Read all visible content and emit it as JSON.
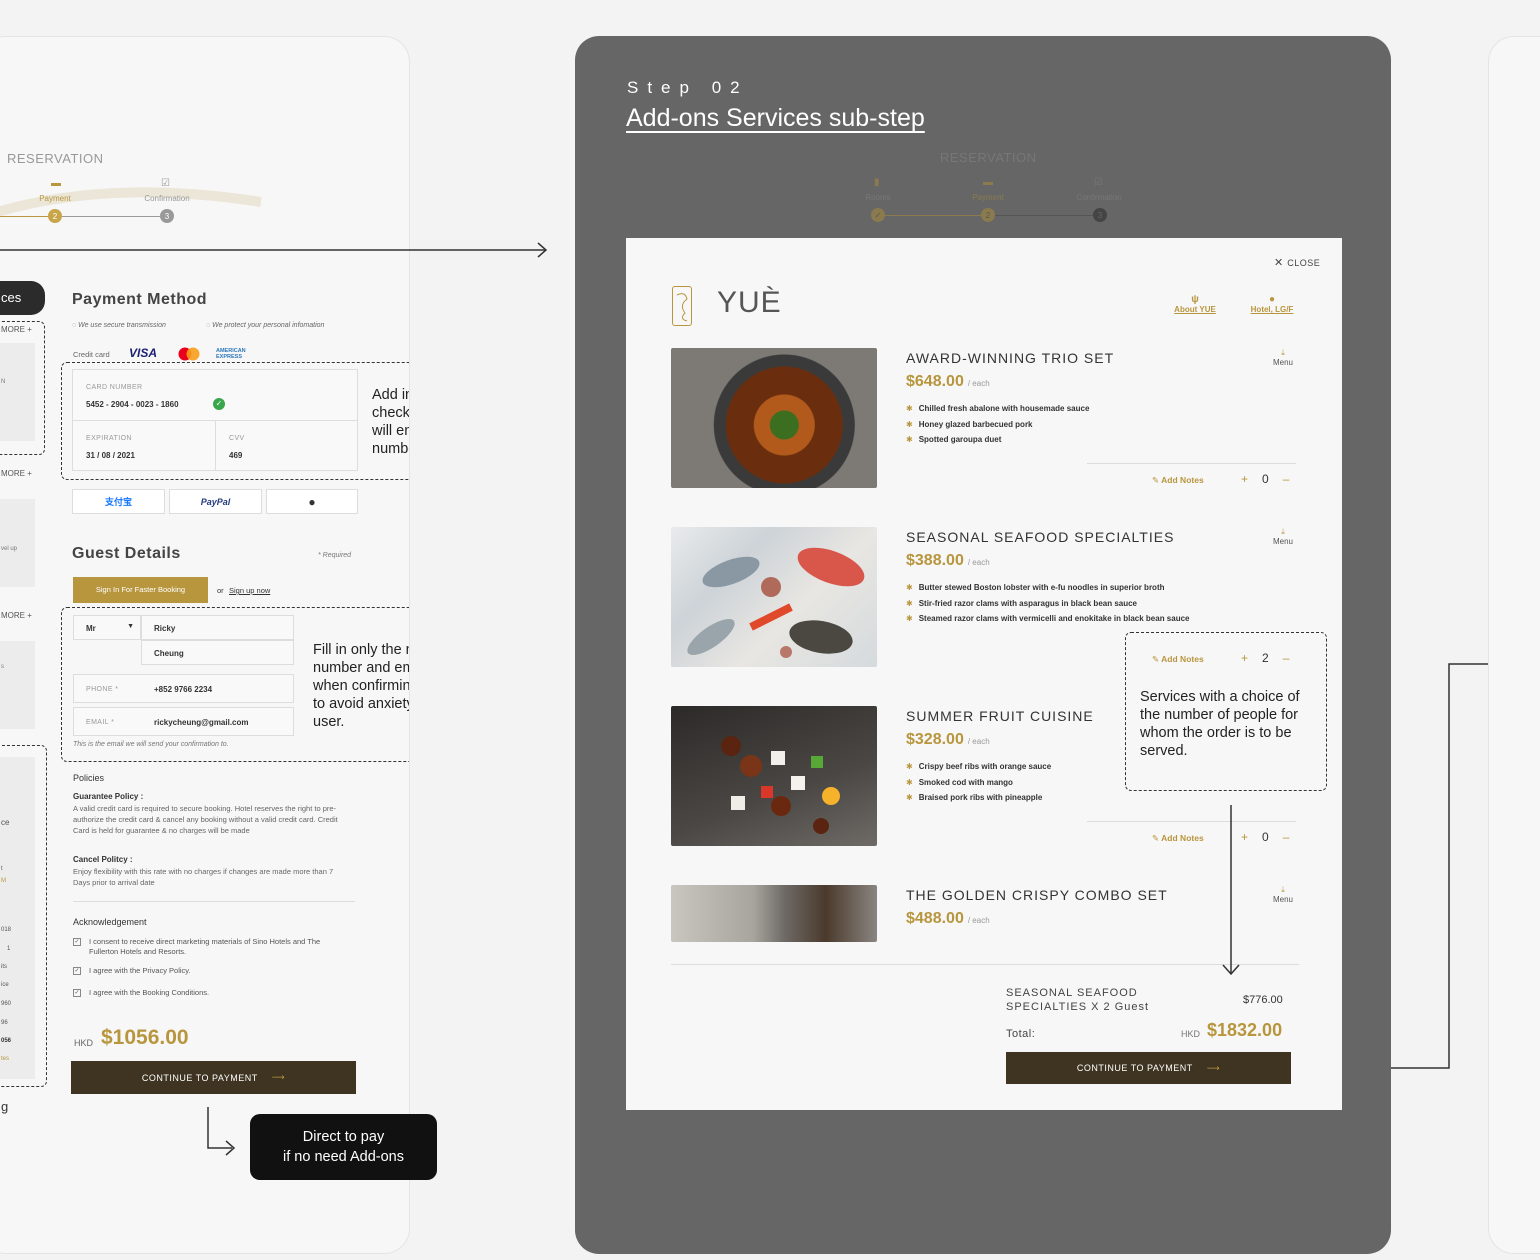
{
  "left": {
    "reservation": "RESERVATION",
    "steps": [
      {
        "label": "Payment",
        "num": "2"
      },
      {
        "label": "Confirmation",
        "num": "3"
      }
    ],
    "tab_partial": "ces",
    "more": "MORE +",
    "side_fragments": [
      "N",
      "vel up",
      "s",
      "ce",
      "t",
      "M",
      "018",
      "1",
      "its",
      "ice",
      "960",
      "96",
      "056",
      "tes",
      "g"
    ],
    "payment_method": {
      "title": "Payment Method",
      "secure1": "We use secure transmission",
      "secure2": "We protect your personal infomation",
      "credit_card": "Credit card",
      "visa": "VISA",
      "amex": "AMERICAN EXPRESS",
      "card_number_label": "CARD NUMBER",
      "card_number": "5452 - 2904 - 0023 - 1860",
      "expiration_label": "EXPIRATION",
      "expiration": "31 / 08 / 2021",
      "cvv_label": "CVV",
      "cvv": "469",
      "alipay": "支付宝",
      "paypal": "PayPal"
    },
    "note_card": "Add in an error checking indicator that will ensure the card number if valid.",
    "guest": {
      "title": "Guest Details",
      "required": "* Required",
      "sign_in": "Sign In For Faster Booking",
      "or": "or",
      "sign_up": "Sign up now",
      "title_value": "Mr",
      "first_name": "Ricky",
      "last_name": "Cheung",
      "phone_label": "PHONE *",
      "phone": "+852 9766 2234",
      "email_label": "EMAIL *",
      "email": "rickycheung@gmail.com",
      "email_hint": "This is the email we will send your confirmation to."
    },
    "note_guest": "Fill in only the name, phone number and email fields when confirming a booking to avoid anxiety for the user.",
    "policies": {
      "title": "Policies",
      "guarantee_title": "Guarantee Policy :",
      "guarantee_text": "A valid credit card is required to secure booking. Hotel reserves the right to pre-authorize the credit card & cancel any booking without a valid credit card. Credit Card is held for guarantee & no charges will be made",
      "cancel_title": "Cancel Politcy :",
      "cancel_text": "Enjoy flexibility with this rate with no charges if changes are made more than 7 Days prior to arrival date"
    },
    "ack": {
      "title": "Acknowledgement",
      "items": [
        "I consent to receive direct marketing materials of Sino Hotels and The Fullerton Hotels and Resorts.",
        "I agree with the Privacy Policy.",
        "I agree with the Booking Conditions."
      ]
    },
    "total_currency": "HKD",
    "total": "$1056.00",
    "continue": "CONTINUE TO PAYMENT"
  },
  "direct_pay": "Direct to pay\nif no need Add-ons",
  "mid": {
    "step": "Step 02",
    "title": "Add-ons Services sub-step",
    "reservation": "RESERVATION",
    "steps": [
      {
        "label": "Rooms",
        "num": "✓"
      },
      {
        "label": "Payment",
        "num": "2"
      },
      {
        "label": "Confirmation",
        "num": "3"
      }
    ],
    "modal": {
      "close": "CLOSE",
      "logo": "YUÈ",
      "about": "About YUE",
      "location": "Hotel, LG/F",
      "menu": "Menu",
      "add_notes": "Add Notes",
      "each": "/ each",
      "items": [
        {
          "title": "AWARD-WINNING TRIO SET",
          "price": "$648.00",
          "features": [
            "Chilled fresh abalone with housemade sauce",
            "Honey glazed barbecued pork",
            "Spotted garoupa duet"
          ],
          "qty": "0"
        },
        {
          "title": "SEASONAL SEAFOOD SPECIALTIES",
          "price": "$388.00",
          "features": [
            "Butter stewed Boston lobster with e-fu noodles in superior broth",
            "Stir-fried razor clams with asparagus in black bean sauce",
            "Steamed razor clams with vermicelli and enokitake in black bean sauce"
          ],
          "qty": "2"
        },
        {
          "title": "SUMMER FRUIT CUISINE",
          "price": "$328.00",
          "features": [
            "Crispy beef ribs with orange sauce",
            "Smoked cod with mango",
            "Braised pork ribs with pineapple"
          ],
          "qty": "0"
        },
        {
          "title": "THE GOLDEN CRISPY COMBO SET",
          "price": "$488.00",
          "features": [],
          "qty": ""
        }
      ],
      "summary_item": "SEASONAL SEAFOOD SPECIALTIES  X 2 Guest",
      "summary_price": "$776.00",
      "total_label": "Total:",
      "total_currency": "HKD",
      "total": "$1832.00",
      "continue": "CONTINUE TO PAYMENT"
    },
    "note_people": "Services with a choice of the number of people for whom the order is to be served."
  }
}
